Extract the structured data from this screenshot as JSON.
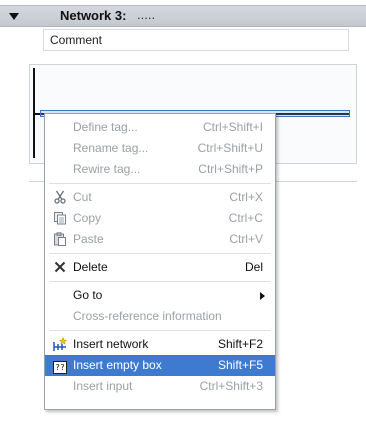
{
  "network": {
    "title": "Network 3:",
    "title_suffix": ".....",
    "comment": "Comment"
  },
  "context_menu": {
    "items": [
      {
        "label": "Define tag...",
        "shortcut": "Ctrl+Shift+I",
        "enabled": false
      },
      {
        "label": "Rename tag...",
        "shortcut": "Ctrl+Shift+U",
        "enabled": false
      },
      {
        "label": "Rewire tag...",
        "shortcut": "Ctrl+Shift+P",
        "enabled": false
      },
      {
        "label": "Cut",
        "shortcut": "Ctrl+X",
        "icon": "scissors-icon",
        "enabled": false
      },
      {
        "label": "Copy",
        "shortcut": "Ctrl+C",
        "icon": "copy-icon",
        "enabled": false
      },
      {
        "label": "Paste",
        "shortcut": "Ctrl+V",
        "icon": "paste-icon",
        "enabled": false
      },
      {
        "label": "Delete",
        "shortcut": "Del",
        "icon": "delete-icon",
        "enabled": true
      },
      {
        "label": "Go to",
        "shortcut": "",
        "submenu": true,
        "enabled": true
      },
      {
        "label": "Cross-reference information",
        "shortcut": "",
        "enabled": false
      },
      {
        "label": "Insert network",
        "shortcut": "Shift+F2",
        "icon": "insert-network-icon",
        "enabled": true
      },
      {
        "label": "Insert empty box",
        "shortcut": "Shift+F5",
        "icon": "empty-box-icon",
        "icon_text": "??",
        "enabled": true,
        "highlighted": true
      },
      {
        "label": "Insert input",
        "shortcut": "Ctrl+Shift+3",
        "enabled": false
      }
    ]
  },
  "colors": {
    "highlight": "#3f7ad1",
    "disabled_text": "#9aa0a6",
    "header_bg": "#c9cdd3"
  }
}
